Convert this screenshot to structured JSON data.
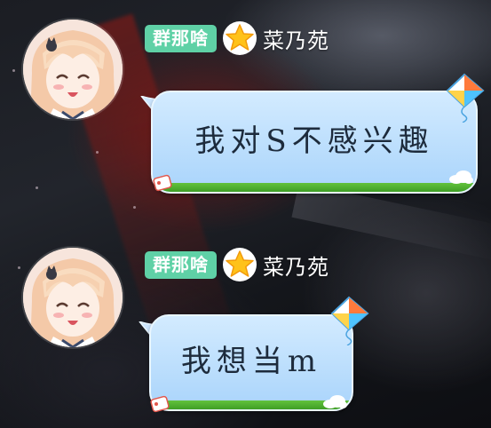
{
  "messages": [
    {
      "group_badge": "群那啥",
      "rank_icon": "star-icon",
      "sender": "菜乃苑",
      "text": "我对S不感兴趣",
      "bubble_colors": {
        "top": "#d3ebff",
        "bottom": "#a9d4fb",
        "grass": "#4fb02e"
      }
    },
    {
      "group_badge": "群那啥",
      "rank_icon": "star-icon",
      "sender": "菜乃苑",
      "text": "我想当m",
      "bubble_colors": {
        "top": "#d3ebff",
        "bottom": "#a9d4fb",
        "grass": "#4fb02e"
      }
    }
  ],
  "colors": {
    "badge": "#5fd1a6",
    "star": "#ffc21a"
  }
}
